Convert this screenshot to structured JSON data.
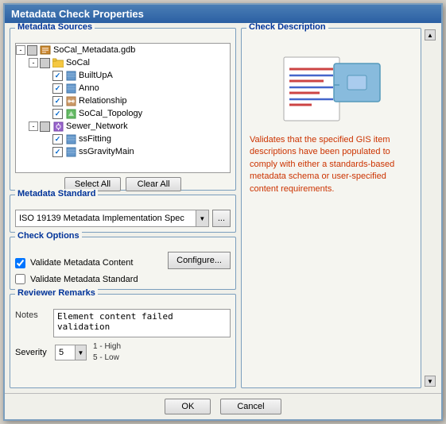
{
  "dialog": {
    "title": "Metadata Check Properties"
  },
  "sections": {
    "metadata_sources": {
      "label": "Metadata Sources",
      "tree": [
        {
          "id": "gdb",
          "level": 0,
          "expanded": true,
          "checkbox": "partial",
          "icon": "gdb",
          "label": "SoCal_Metadata.gdb"
        },
        {
          "id": "socal",
          "level": 1,
          "expanded": true,
          "checkbox": "partial",
          "icon": "folder",
          "label": "SoCal"
        },
        {
          "id": "builtupp",
          "level": 2,
          "expanded": false,
          "checkbox": "checked",
          "icon": "feature",
          "label": "BuiltUpA"
        },
        {
          "id": "anno",
          "level": 2,
          "expanded": false,
          "checkbox": "checked",
          "icon": "feature",
          "label": "Anno"
        },
        {
          "id": "relationship",
          "level": 2,
          "expanded": false,
          "checkbox": "checked",
          "icon": "relation",
          "label": "Relationship"
        },
        {
          "id": "socal_topology",
          "level": 2,
          "expanded": false,
          "checkbox": "checked",
          "icon": "topology",
          "label": "SoCal_Topology"
        },
        {
          "id": "sewer_network",
          "level": 1,
          "expanded": true,
          "checkbox": "partial",
          "icon": "network",
          "label": "Sewer_Network"
        },
        {
          "id": "ssfitting",
          "level": 2,
          "expanded": false,
          "checkbox": "checked",
          "icon": "feature",
          "label": "ssFitting"
        },
        {
          "id": "ssgravitymain",
          "level": 2,
          "expanded": false,
          "checkbox": "checked",
          "icon": "feature",
          "label": "ssGravityMain"
        }
      ],
      "select_all": "Select All",
      "clear_all": "Clear All"
    },
    "metadata_standard": {
      "label": "Metadata Standard",
      "value": "ISO 19139 Metadata Implementation Spec",
      "browse_label": "..."
    },
    "check_options": {
      "label": "Check Options",
      "validate_content": {
        "label": "Validate Metadata Content",
        "checked": true
      },
      "validate_standard": {
        "label": "Validate Metadata Standard",
        "checked": false
      },
      "configure_label": "Configure..."
    },
    "reviewer_remarks": {
      "label": "Reviewer Remarks",
      "notes_label": "Notes",
      "notes_value": "Element content failed validation",
      "severity_label": "Severity",
      "severity_value": "5",
      "severity_hint_high": "1 - High",
      "severity_hint_low": "5 - Low"
    }
  },
  "check_description": {
    "label": "Check Description",
    "text": "Validates that the specified GIS item descriptions have been populated to comply with either a standards-based metadata schema or user-specified content requirements."
  },
  "footer": {
    "ok_label": "OK",
    "cancel_label": "Cancel"
  }
}
